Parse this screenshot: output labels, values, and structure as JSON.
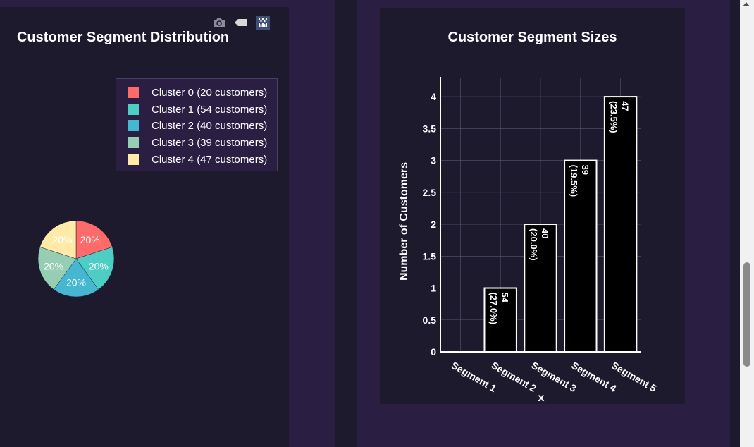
{
  "colors": {
    "page_bg": "#2a1f42",
    "panel_bg": "#1e1a2e",
    "pie": [
      "#ff6b6b",
      "#4ecdc4",
      "#45b7d1",
      "#96ceb4",
      "#ffeaa7"
    ],
    "bar_fill": "#000000",
    "bar_stroke": "#ffffff",
    "grid": "#5a5470"
  },
  "modebar": {
    "icons": [
      "camera-icon",
      "tag-icon",
      "plotly-logo-icon"
    ]
  },
  "chart_data": [
    {
      "type": "pie",
      "title": "Customer Segment Distribution",
      "labels": [
        "Cluster 0 (20 customers)",
        "Cluster 1 (54 customers)",
        "Cluster 2 (40 customers)",
        "Cluster 3 (39 customers)",
        "Cluster 4 (47 customers)"
      ],
      "values": [
        20,
        20,
        20,
        20,
        20
      ],
      "slice_labels": [
        "20%",
        "20%",
        "20%",
        "20%",
        "20%"
      ],
      "legend_position": "top-right"
    },
    {
      "type": "bar",
      "title": "Customer Segment Sizes",
      "xlabel": "x",
      "ylabel": "Number of Customers",
      "categories": [
        "Segment 1",
        "Segment 2",
        "Segment 3",
        "Segment 4",
        "Segment 5"
      ],
      "values": [
        0,
        1,
        2,
        3,
        4
      ],
      "bar_texts": [
        [
          "",
          ""
        ],
        [
          "54",
          "(27.0%)"
        ],
        [
          "40",
          "(20.0%)"
        ],
        [
          "39",
          "(19.5%)"
        ],
        [
          "47",
          "(23.5%)"
        ]
      ],
      "ylim": [
        0,
        4.2
      ],
      "yticks": [
        0,
        0.5,
        1,
        1.5,
        2,
        2.5,
        3,
        3.5,
        4
      ],
      "ytick_labels": [
        "0",
        "0.5",
        "1",
        "1.5",
        "2",
        "2.5",
        "3",
        "3.5",
        "4"
      ],
      "grid": true
    }
  ]
}
